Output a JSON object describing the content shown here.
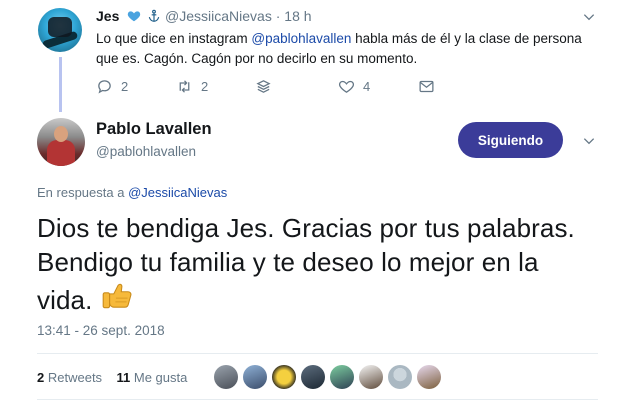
{
  "reply_tweet": {
    "name": "Jes",
    "handle": "@JessiicaNievas",
    "separator": "·",
    "time": "18 h",
    "text_before": "Lo que dice en instagram ",
    "mention": "@pablohlavallen",
    "text_after": " habla más de él y la clase de persona que es. Cagón. Cagón  por no decirlo en su momento.",
    "replies": "2",
    "retweets": "2",
    "likes": "4",
    "icons": [
      "heart-icon",
      "anchor-icon",
      "chevron-down-icon",
      "reply-icon",
      "retweet-icon",
      "stack-icon",
      "like-icon",
      "message-icon"
    ]
  },
  "main_tweet": {
    "name": "Pablo Lavallen",
    "handle": "@pablohlavallen",
    "follow_label": "Siguiendo",
    "replying_prefix": "En respuesta a ",
    "replying_to": "@JessiicaNievas",
    "text": "Dios te bendiga Jes. Gracias por tus palabras. Bendigo tu familia y te deseo lo mejor en la vida.",
    "emoji": "thumbs-up",
    "timestamp": "13:41 - 26 sept. 2018",
    "retweets_count": "2",
    "retweets_label": "Retweets",
    "likes_count": "11",
    "likes_label": "Me gusta"
  },
  "colors": {
    "follow_button": "#3b3c99",
    "link": "#1b4aa8",
    "muted": "#657786",
    "thread_line": "#b8c3f0",
    "heart": "#4aa3df"
  }
}
